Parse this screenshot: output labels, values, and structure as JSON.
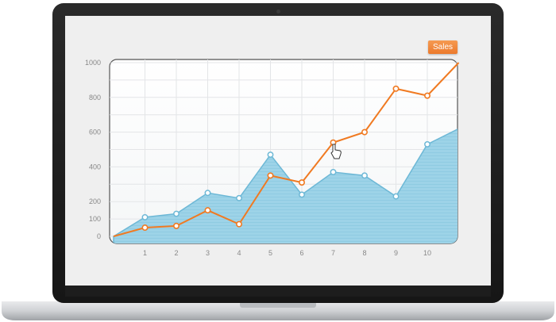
{
  "legend": {
    "label": "Sales",
    "color": "#ee7d31"
  },
  "colors": {
    "line": "#f07a22",
    "area_fill": "#9dd3e8",
    "area_stroke": "#6db8d6"
  },
  "chart_data": {
    "type": "line",
    "title": "",
    "xlabel": "",
    "ylabel": "",
    "x_ticks": [
      1,
      2,
      3,
      4,
      5,
      6,
      7,
      8,
      9,
      10
    ],
    "y_ticks": [
      0,
      100,
      200,
      300,
      400,
      500,
      600,
      700,
      800,
      900,
      1000
    ],
    "y_tick_labels": [
      "0",
      "100",
      "200",
      "400",
      "600",
      "800",
      "1000"
    ],
    "xlim": [
      0,
      11
    ],
    "grid": true,
    "legend_position": "top-right",
    "series": [
      {
        "name": "Sales",
        "style": "line",
        "x": [
          0,
          1,
          2,
          3,
          4,
          5,
          6,
          7,
          8,
          9,
          10,
          11
        ],
        "values": [
          0,
          50,
          60,
          150,
          70,
          350,
          310,
          540,
          600,
          850,
          810,
          1000
        ]
      },
      {
        "name": "",
        "style": "area",
        "x": [
          0,
          1,
          2,
          3,
          4,
          5,
          6,
          7,
          8,
          9,
          10,
          11
        ],
        "values": [
          0,
          110,
          130,
          250,
          220,
          470,
          240,
          370,
          350,
          230,
          530,
          620
        ]
      }
    ]
  }
}
